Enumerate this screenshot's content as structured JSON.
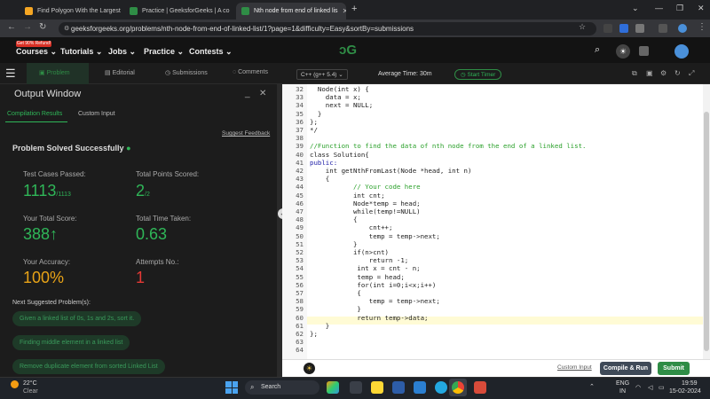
{
  "browser": {
    "tabs": [
      {
        "title": "Find Polygon With the Largest",
        "favicon_color": "#f5a623"
      },
      {
        "title": "Practice | GeeksforGeeks | A co",
        "favicon_color": "#2f8d46"
      },
      {
        "title": "Nth node from end of linked lis",
        "favicon_color": "#2f8d46"
      }
    ],
    "new_tab": "+",
    "url": "geeksforgeeks.org/problems/nth-node-from-end-of-linked-list/1?page=1&difficulty=Easy&sortBy=submissions",
    "window_controls": [
      "⌄",
      "—",
      "❐",
      "✕"
    ]
  },
  "site": {
    "logo": "ↄG",
    "promo": "Get 90% Refund!",
    "nav": [
      "Courses",
      "Tutorials",
      "Jobs",
      "Practice",
      "Contests"
    ],
    "avatar_color": "#4a90d9"
  },
  "problem_tabs": [
    "Problem",
    "Editorial",
    "Submissions",
    "Comments"
  ],
  "output": {
    "title": "Output Window",
    "subtabs": [
      "Compilation Results",
      "Custom Input"
    ],
    "suggest_feedback": "Suggest Feedback",
    "status": "Problem Solved Successfully",
    "stats": [
      {
        "label": "Test Cases Passed:",
        "value": "1113",
        "suffix": "/1113"
      },
      {
        "label": "Total Points Scored:",
        "value": "2",
        "suffix": "/2"
      },
      {
        "label": "Your Total Score:",
        "value": "388",
        "suffix": "↑"
      },
      {
        "label": "Total Time Taken:",
        "value": "0.63",
        "suffix": ""
      },
      {
        "label": "Your Accuracy:",
        "value": "100%",
        "suffix": ""
      },
      {
        "label": "Attempts No.:",
        "value": "1",
        "suffix": ""
      }
    ],
    "next_title": "Next Suggested Problem(s):",
    "next_problems": [
      "Given a linked list of 0s, 1s and 2s, sort it.",
      "Finding middle element in a linked list",
      "Remove duplicate element from sorted Linked List"
    ]
  },
  "editor_bar": {
    "language": "C++ (g++ 5.4)",
    "average_time": "Average Time: 30m",
    "timer": "Start Timer"
  },
  "code_lines": [
    {
      "n": "32",
      "t": "  Node(int x) {",
      "c": ""
    },
    {
      "n": "33",
      "t": "    data = x;",
      "c": ""
    },
    {
      "n": "34",
      "t": "    next = NULL;",
      "c": ""
    },
    {
      "n": "35",
      "t": "  }",
      "c": ""
    },
    {
      "n": "36",
      "t": "};",
      "c": ""
    },
    {
      "n": "37",
      "t": "*/",
      "c": ""
    },
    {
      "n": "38",
      "t": "",
      "c": ""
    },
    {
      "n": "39",
      "t": "//Function to find the data of nth node from the end of a linked list.",
      "c": "cm"
    },
    {
      "n": "40",
      "t": "class Solution{",
      "c": ""
    },
    {
      "n": "41",
      "t": "public:",
      "c": "kw"
    },
    {
      "n": "42",
      "t": "    int getNthFromLast(Node *head, int n)",
      "c": ""
    },
    {
      "n": "43",
      "t": "    {",
      "c": ""
    },
    {
      "n": "44",
      "t": "           // Your code here",
      "c": "cm"
    },
    {
      "n": "45",
      "t": "           int cnt;",
      "c": ""
    },
    {
      "n": "46",
      "t": "           Node*temp = head;",
      "c": ""
    },
    {
      "n": "47",
      "t": "           while(temp!=NULL)",
      "c": ""
    },
    {
      "n": "48",
      "t": "           {",
      "c": ""
    },
    {
      "n": "49",
      "t": "               cnt++;",
      "c": ""
    },
    {
      "n": "50",
      "t": "               temp = temp->next;",
      "c": ""
    },
    {
      "n": "51",
      "t": "           }",
      "c": ""
    },
    {
      "n": "52",
      "t": "           if(n>cnt)",
      "c": ""
    },
    {
      "n": "53",
      "t": "               return -1;",
      "c": ""
    },
    {
      "n": "54",
      "t": "            int x = cnt - n;",
      "c": ""
    },
    {
      "n": "55",
      "t": "            temp = head;",
      "c": ""
    },
    {
      "n": "56",
      "t": "            for(int i=0;i<x;i++)",
      "c": ""
    },
    {
      "n": "57",
      "t": "            {",
      "c": ""
    },
    {
      "n": "58",
      "t": "               temp = temp->next;",
      "c": ""
    },
    {
      "n": "59",
      "t": "            }",
      "c": ""
    },
    {
      "n": "60",
      "t": "            return temp->data;",
      "c": ""
    },
    {
      "n": "61",
      "t": "    }",
      "c": ""
    },
    {
      "n": "62",
      "t": "};",
      "c": ""
    },
    {
      "n": "63",
      "t": "",
      "c": ""
    },
    {
      "n": "64",
      "t": "",
      "c": ""
    }
  ],
  "bottom_bar": {
    "custom_input": "Custom Input",
    "compile": "Compile & Run",
    "submit": "Submit"
  },
  "taskbar": {
    "temp": "22°C",
    "weather": "Clear",
    "search": "Search",
    "lang1": "ENG",
    "lang2": "IN",
    "time": "19:59",
    "date": "15-02-2024"
  }
}
